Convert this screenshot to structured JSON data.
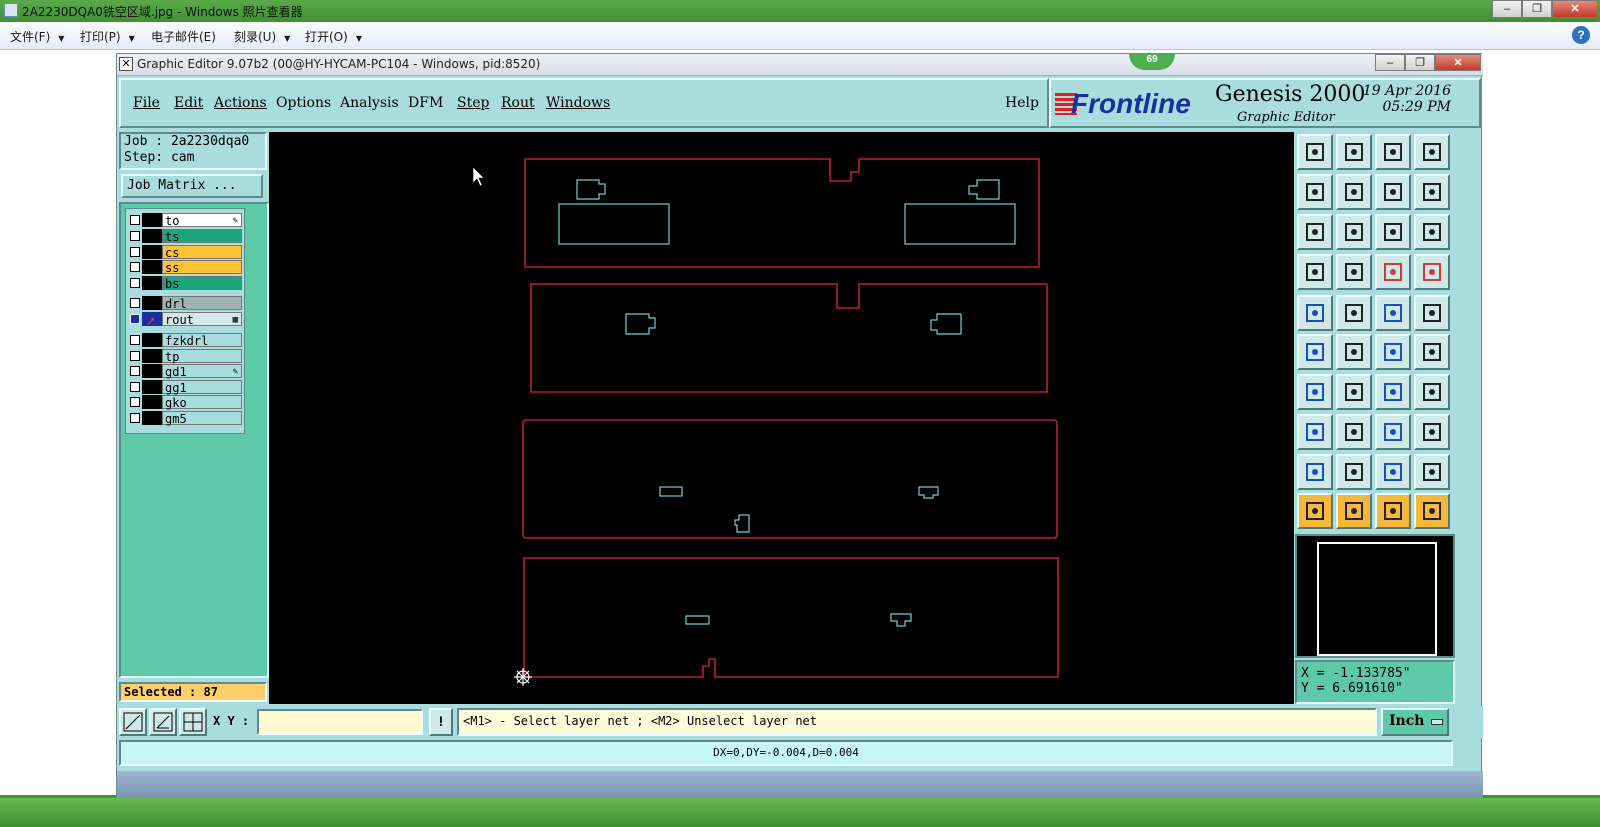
{
  "photo_viewer": {
    "title": "2A2230DQA0铣空区域.jpg - Windows 照片查看器",
    "menu": [
      "文件(F)",
      "打印(P)",
      "电子邮件(E)",
      "刻录(U)",
      "打开(O)"
    ],
    "help": "?"
  },
  "genesis": {
    "title": "Graphic Editor 9.07b2 (00@HY-HYCAM-PC104 - Windows, pid:8520)",
    "badge": "69",
    "menu": [
      "File",
      "Edit",
      "Actions",
      "Options",
      "Analysis",
      "DFM",
      "Step",
      "Rout",
      "Windows"
    ],
    "help": "Help",
    "brand": {
      "logo": "Frontline",
      "product": "Genesis 2000",
      "subtitle": "Graphic Editor",
      "date": "19 Apr 2016",
      "time": "05:29 PM"
    },
    "job": "Job : 2a2230dqa0",
    "step": "Step: cam",
    "job_matrix_button": "Job Matrix ...",
    "layers": [
      {
        "name": "to",
        "color": "#ffffff"
      },
      {
        "name": "ts",
        "color": "#1aa67a"
      },
      {
        "name": "cs",
        "color": "#ffc233"
      },
      {
        "name": "ss",
        "color": "#ffc233"
      },
      {
        "name": "bs",
        "color": "#1aa67a"
      },
      {
        "name": "drl",
        "color": "#9fb4b4"
      },
      {
        "name": "rout",
        "color": "#d8e8e8"
      },
      {
        "name": "fzkdrl",
        "color": "#a9dcdc"
      },
      {
        "name": "tp",
        "color": "#a9dcdc"
      },
      {
        "name": "gd1",
        "color": "#a9dcdc"
      },
      {
        "name": "gg1",
        "color": "#a9dcdc"
      },
      {
        "name": "gko",
        "color": "#a9dcdc"
      },
      {
        "name": "gm5",
        "color": "#a9dcdc"
      }
    ],
    "selected": "Selected : 87",
    "coords": {
      "x": "X = -1.133785\"",
      "y": "Y =  6.691610\""
    },
    "xy_label": "X Y :",
    "xy_value": "",
    "prompt": "<M1> - Select layer net ; <M2> Unselect layer net",
    "unit": "Inch",
    "status": "DX=0,DY=-0.004,D=0.004",
    "colors": {
      "outline": "#e02a2a",
      "feature": "#6ecfd6",
      "canvas": "#000000"
    }
  }
}
